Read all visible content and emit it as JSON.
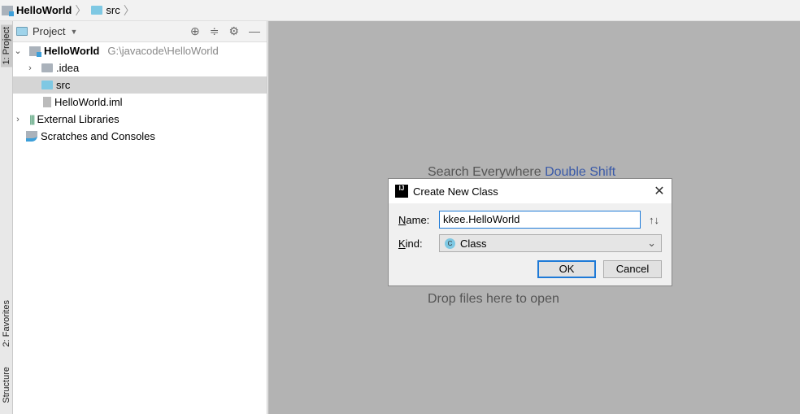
{
  "breadcrumb": {
    "project": "HelloWorld",
    "folder": "src"
  },
  "side_strip": {
    "project": "1: Project",
    "favorites": "2: Favorites",
    "structure": "Structure"
  },
  "panel": {
    "title": "Project",
    "tools": [
      "locate-icon",
      "collapse-icon",
      "gear-icon",
      "minimize-icon"
    ]
  },
  "tree": {
    "root": {
      "label": "HelloWorld",
      "path": "G:\\javacode\\HelloWorld"
    },
    "idea": ".idea",
    "src": "src",
    "iml": "HelloWorld.iml",
    "libs": "External Libraries",
    "scratches": "Scratches and Consoles"
  },
  "editor": {
    "search_hint": "Search Everywhere",
    "search_key": "Double Shift",
    "drop_hint": "Drop files here to open"
  },
  "dialog": {
    "title": "Create New Class",
    "name_label_u": "N",
    "name_label": "ame:",
    "name_value": "kkee.HelloWorld",
    "kind_label_u": "K",
    "kind_label": "ind:",
    "kind_value": "Class",
    "kind_icon": "C",
    "ok": "OK",
    "cancel": "Cancel"
  },
  "colors": {
    "accent": "#1e7ad7",
    "folder": "#7ec8e3",
    "editor_bg": "#b3b3b3"
  }
}
